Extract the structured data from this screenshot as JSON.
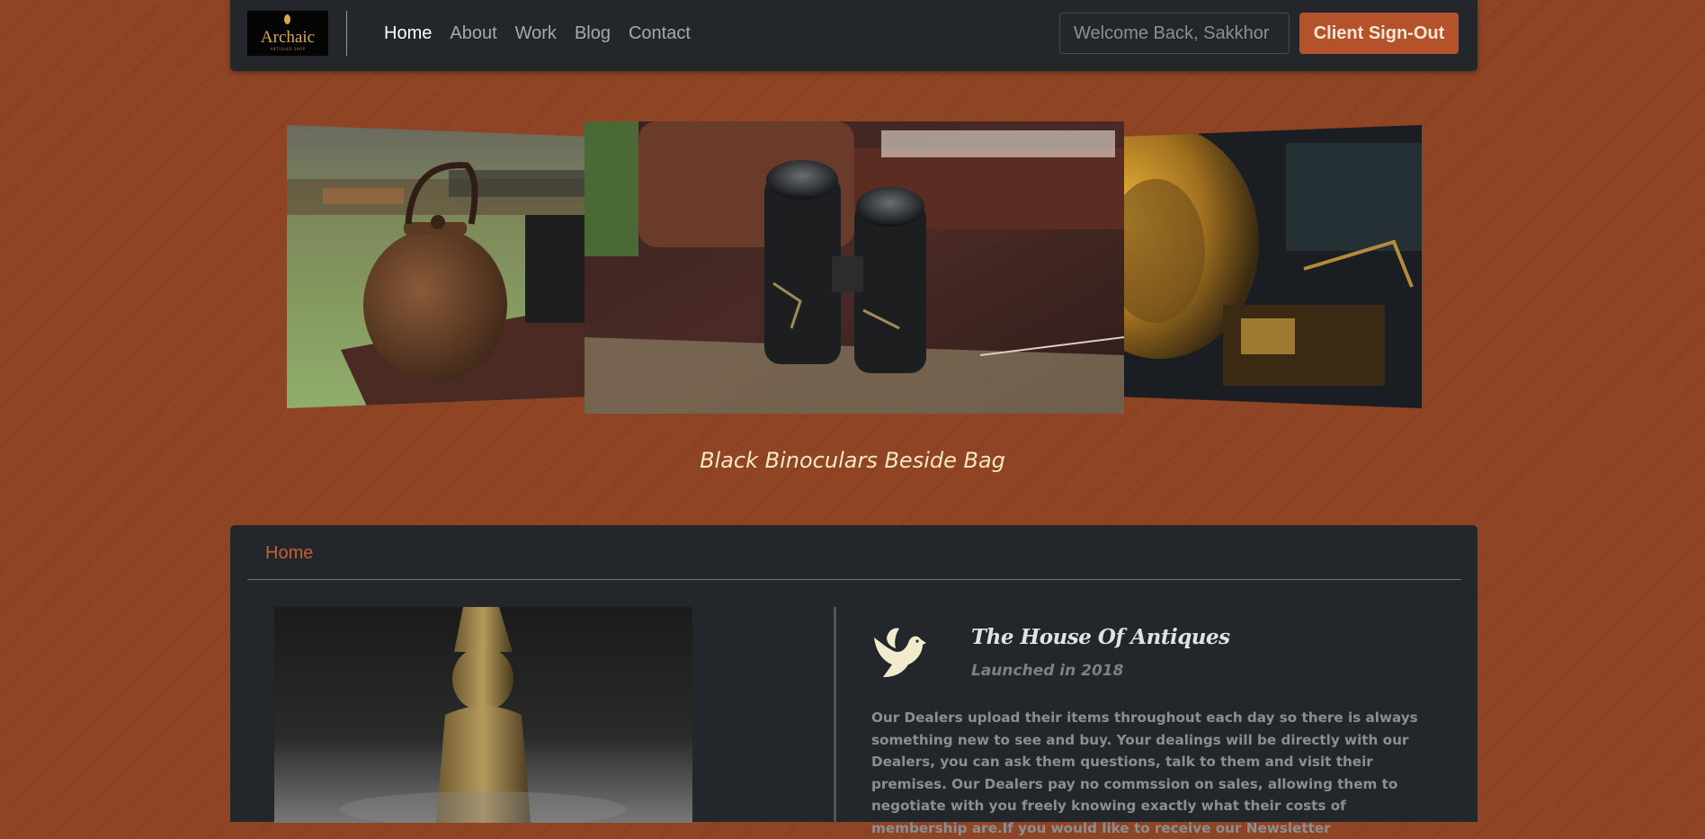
{
  "navbar": {
    "logo_text": "Archaic",
    "logo_subtext": "ANTIQUES SHOP",
    "links": [
      "Home",
      "About",
      "Work",
      "Blog",
      "Contact"
    ],
    "active_link": "Home",
    "welcome_placeholder": "Welcome Back, Sakkhor",
    "signout_label": "Client Sign-Out"
  },
  "carousel": {
    "slides": [
      "kettle-photo",
      "binoculars-photo",
      "gramophone-photo"
    ],
    "caption": "Black Binoculars Beside Bag"
  },
  "breadcrumb": {
    "current": "Home"
  },
  "about": {
    "icon": "dove-icon",
    "title": "The House Of Antiques",
    "subtitle": "Launched in 2018",
    "body": "Our Dealers upload their items throughout each day so there is always something new to see and buy. Your dealings will be directly with our Dealers, you can ask them questions, talk to them and visit their premises. Our Dealers pay no commssion on sales, allowing them to negotiate with you freely knowing exactly what their costs of membership are.If you would like to receive our Newsletter"
  },
  "colors": {
    "background": "#8f4424",
    "panel": "#23272b",
    "accent": "#b4532b",
    "caption": "#f7e8c4"
  }
}
